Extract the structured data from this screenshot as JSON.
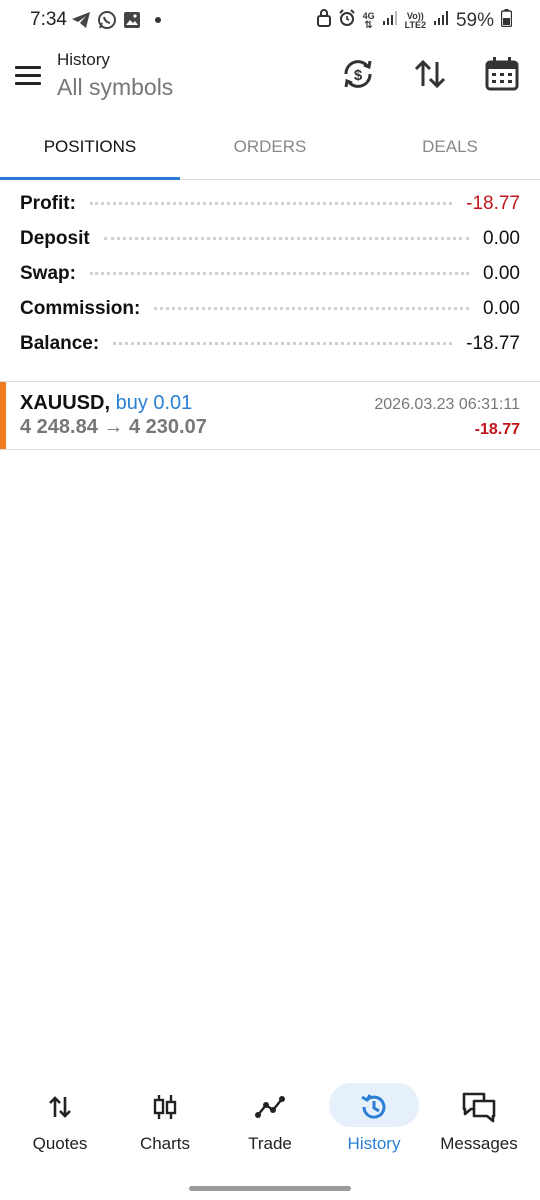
{
  "status_bar": {
    "time": "7:34",
    "network_top": "4G",
    "volte_top": "Vo))",
    "volte_bottom": "LTE2",
    "battery": "59%"
  },
  "header": {
    "title": "History",
    "subtitle": "All symbols"
  },
  "tabs": [
    {
      "label": "POSITIONS",
      "active": true
    },
    {
      "label": "ORDERS",
      "active": false
    },
    {
      "label": "DEALS",
      "active": false
    }
  ],
  "summary": [
    {
      "label": "Profit:",
      "value": "-18.77"
    },
    {
      "label": "Deposit",
      "value": "0.00"
    },
    {
      "label": "Swap:",
      "value": "0.00"
    },
    {
      "label": "Commission:",
      "value": "0.00"
    },
    {
      "label": "Balance:",
      "value": "-18.77"
    }
  ],
  "positions": [
    {
      "symbol": "XAUUSD,",
      "side": "buy 0.01",
      "prices": "4 248.84 → 4 230.07",
      "datetime": "2026.03.23 06:31:11",
      "profit": "-18.77"
    }
  ],
  "nav": [
    {
      "label": "Quotes",
      "icon": "quotes-arrows-icon",
      "active": false
    },
    {
      "label": "Charts",
      "icon": "candlestick-icon",
      "active": false
    },
    {
      "label": "Trade",
      "icon": "trend-line-icon",
      "active": false
    },
    {
      "label": "History",
      "icon": "history-clock-icon",
      "active": true
    },
    {
      "label": "Messages",
      "icon": "chat-bubbles-icon",
      "active": false
    }
  ],
  "colors": {
    "accent": "#2a7fd4",
    "negative": "#c0151b",
    "buy_bar": "#f07d22"
  }
}
